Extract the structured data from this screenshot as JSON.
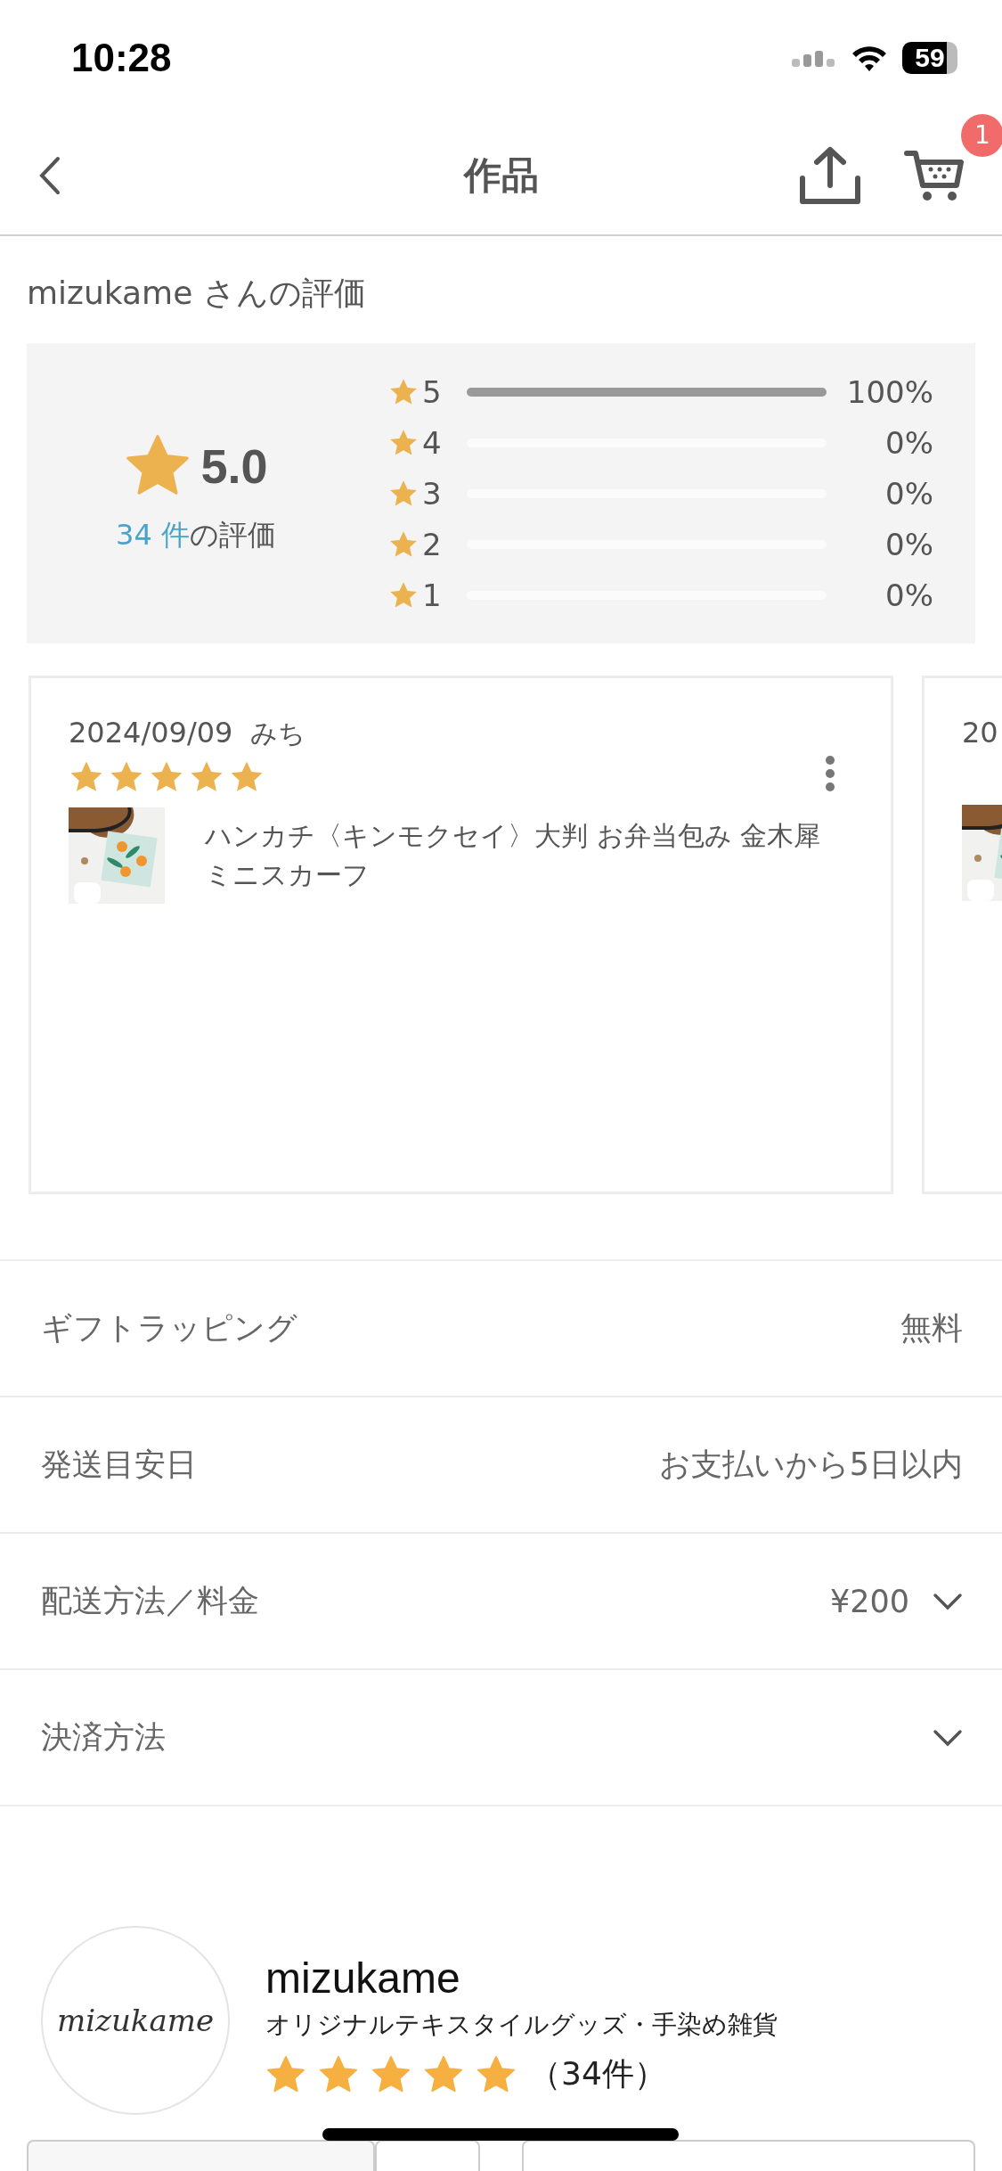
{
  "status_bar": {
    "time": "10:28",
    "battery": "59"
  },
  "header": {
    "title": "作品",
    "cart_count": "1"
  },
  "ratings": {
    "heading": "mizukame さんの評価",
    "average": "5.0",
    "count": "34 件",
    "count_suffix": "の評価",
    "bars": [
      {
        "label": "5",
        "level": 1,
        "percent": "100%"
      },
      {
        "label": "4",
        "level": 0,
        "percent": "0%"
      },
      {
        "label": "3",
        "level": 0,
        "percent": "0%"
      },
      {
        "label": "2",
        "level": 0,
        "percent": "0%"
      },
      {
        "label": "1",
        "level": 0,
        "percent": "0%"
      }
    ]
  },
  "reviews": [
    {
      "date": "2024/09/09",
      "name": "みち",
      "stars": 5,
      "product": "ハンカチ〈キンモクセイ〉大判 お弁当包み 金木犀ミニスカーフ"
    },
    {
      "date": "20"
    }
  ],
  "details": [
    {
      "kind": "text",
      "label": "ギフトラッピング",
      "value": "無料"
    },
    {
      "kind": "text",
      "label": "発送目安日",
      "value": "お支払いから5日以内"
    },
    {
      "kind": "select",
      "label": "配送方法／料金",
      "value": "¥200"
    },
    {
      "kind": "select",
      "label": "決済方法"
    }
  ],
  "shop": {
    "logo": "mizukame",
    "name": "mizukame",
    "tagline": "オリジナルテキスタイルグッズ・手染め雑貨",
    "stars": 5,
    "count": "（34件）"
  }
}
